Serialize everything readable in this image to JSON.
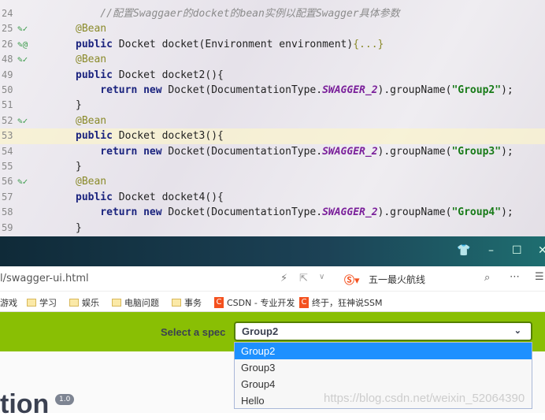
{
  "editor": {
    "lines": [
      {
        "n": "24",
        "parts": [
          [
            "cm",
            "    //配置Swaggaer的docket的bean实例以配置Swagger具体参数"
          ]
        ]
      },
      {
        "n": "25",
        "g": "✎✓",
        "parts": [
          [
            "ann",
            "@Bean"
          ]
        ]
      },
      {
        "n": "26",
        "g": "✎@",
        "parts": [
          [
            "kw",
            "public"
          ],
          [
            "",
            "Docket docket(Environment environment)"
          ],
          [
            "ann",
            "{...}"
          ]
        ]
      },
      {
        "n": "48",
        "g": "✎✓",
        "parts": [
          [
            "ann",
            "@Bean"
          ]
        ]
      },
      {
        "n": "49",
        "parts": [
          [
            "kw",
            "public"
          ],
          [
            "",
            "Docket docket2(){"
          ]
        ]
      },
      {
        "n": "50",
        "parts": [
          [
            "kw",
            "    return new"
          ],
          [
            "",
            "Docket(DocumentationType."
          ],
          [
            "it",
            "SWAGGER_2"
          ],
          [
            "",
            ").groupName("
          ],
          [
            "st",
            "\"Group2\""
          ],
          [
            "",
            ");"
          ]
        ]
      },
      {
        "n": "51",
        "parts": [
          [
            "",
            "}"
          ]
        ]
      },
      {
        "n": "52",
        "g": "✎✓",
        "parts": [
          [
            "ann",
            "@Bean"
          ]
        ]
      },
      {
        "n": "53",
        "hl": true,
        "parts": [
          [
            "kw",
            "public"
          ],
          [
            "",
            "Docket docket3(){"
          ]
        ]
      },
      {
        "n": "54",
        "parts": [
          [
            "kw",
            "    return new"
          ],
          [
            "",
            "Docket(DocumentationType."
          ],
          [
            "it",
            "SWAGGER_2"
          ],
          [
            "",
            ").groupName("
          ],
          [
            "st",
            "\"Group3\""
          ],
          [
            "",
            ");"
          ]
        ]
      },
      {
        "n": "55",
        "parts": [
          [
            "",
            "}"
          ]
        ]
      },
      {
        "n": "56",
        "g": "✎✓",
        "parts": [
          [
            "ann",
            "@Bean"
          ]
        ]
      },
      {
        "n": "57",
        "parts": [
          [
            "kw",
            "public"
          ],
          [
            "",
            "Docket docket4(){"
          ]
        ]
      },
      {
        "n": "58",
        "parts": [
          [
            "kw",
            "    return new"
          ],
          [
            "",
            "Docket(DocumentationType."
          ],
          [
            "it",
            "SWAGGER_2"
          ],
          [
            "",
            ").groupName("
          ],
          [
            "st",
            "\"Group4\""
          ],
          [
            "",
            ");"
          ]
        ]
      },
      {
        "n": "59",
        "parts": [
          [
            "",
            "}"
          ]
        ]
      }
    ]
  },
  "browser": {
    "url": "l/swagger-ui.html",
    "search_text": "五一最火航线",
    "bookmarks": [
      {
        "label": "游戏",
        "type": "text"
      },
      {
        "label": "学习",
        "type": "folder"
      },
      {
        "label": "娱乐",
        "type": "folder"
      },
      {
        "label": "电脑问题",
        "type": "folder"
      },
      {
        "label": "事务",
        "type": "folder"
      },
      {
        "label": "CSDN - 专业开发",
        "type": "csdn"
      },
      {
        "label": "终于，狂神说SSM",
        "type": "csdn"
      }
    ]
  },
  "swagger": {
    "select_label": "Select a spec",
    "selected": "Group2",
    "options": [
      "Group2",
      "Group3",
      "Group4",
      "Hello"
    ],
    "title_fragment": "tion",
    "version": "1.0",
    "accent": "#89bf04"
  },
  "watermark": "https://blog.csdn.net/weixin_52064390"
}
